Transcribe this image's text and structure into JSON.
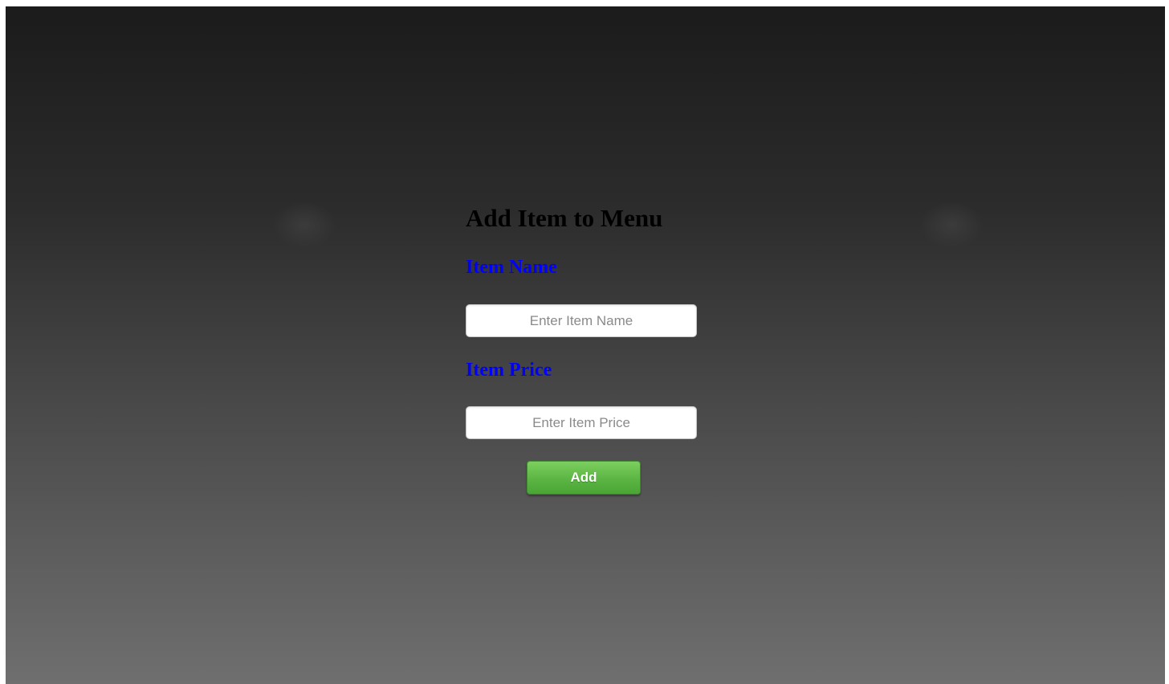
{
  "form": {
    "title": "Add Item to Menu",
    "item_name_label": "Item Name",
    "item_name_placeholder": "Enter Item Name",
    "item_price_label": "Item Price",
    "item_price_placeholder": "Enter Item Price",
    "add_button_label": "Add"
  },
  "colors": {
    "label_color": "#0000ff",
    "button_green": "#5cb543"
  }
}
